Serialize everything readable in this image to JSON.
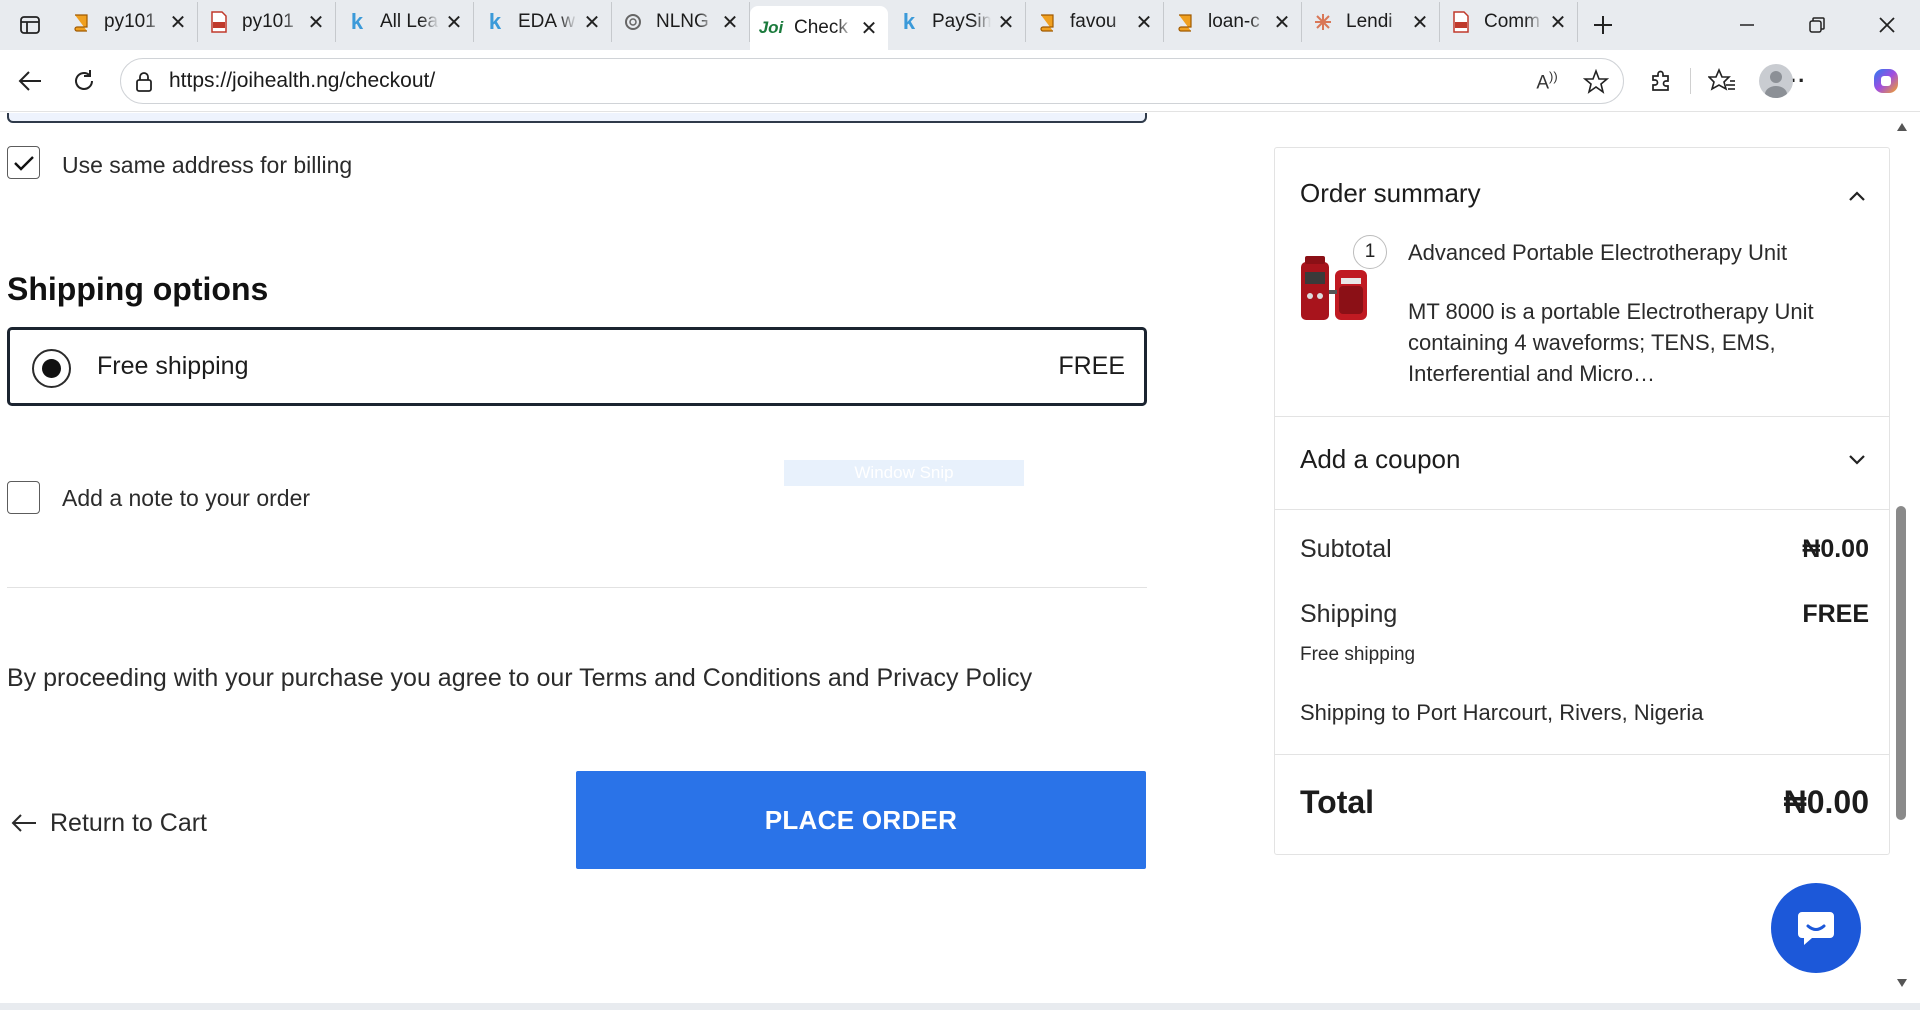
{
  "browser": {
    "tabs": [
      {
        "label": "py101",
        "icon": "book-icon",
        "color": "#f0a020"
      },
      {
        "label": "py101",
        "icon": "pdf-icon",
        "color": "#c0392b"
      },
      {
        "label": "All Lea",
        "icon": "k-icon",
        "color": "#3b9ad9"
      },
      {
        "label": "EDA w",
        "icon": "k-icon",
        "color": "#3b9ad9"
      },
      {
        "label": "NLNG",
        "icon": "openai-icon",
        "color": "#666666"
      },
      {
        "label": "Check",
        "icon": "joi-icon",
        "color": "#1a7a3c",
        "active": true
      },
      {
        "label": "PaySim",
        "icon": "k-icon",
        "color": "#3b9ad9"
      },
      {
        "label": "favou",
        "icon": "book-icon",
        "color": "#f0a020"
      },
      {
        "label": "loan-c",
        "icon": "book-icon",
        "color": "#f0a020"
      },
      {
        "label": "Lendi",
        "icon": "claude-icon",
        "color": "#d97757"
      },
      {
        "label": "Comm",
        "icon": "pdf-icon",
        "color": "#c0392b"
      }
    ],
    "url": "https://joihealth.ng/checkout/"
  },
  "checkout": {
    "billing_same_label": "Use same address for billing",
    "shipping_title": "Shipping options",
    "shipping_option": {
      "name": "Free shipping",
      "price": "FREE"
    },
    "note_label": "Add a note to your order",
    "snip_overlay": "Window Snip",
    "terms_text": "By proceeding with your purchase you agree to our Terms and Conditions and Privacy Policy",
    "return_label": "Return to Cart",
    "place_order_label": "PLACE ORDER"
  },
  "summary": {
    "title": "Order summary",
    "quantity": "1",
    "product_name": "Advanced Portable Electrotherapy Unit",
    "product_desc": "MT 8000 is a portable Electrotherapy Unit containing 4 waveforms; TENS, EMS, Interferential and Micro…",
    "coupon_label": "Add a coupon",
    "subtotal_label": "Subtotal",
    "subtotal_value": "₦0.00",
    "shipping_label": "Shipping",
    "shipping_value": "FREE",
    "shipping_method": "Free shipping",
    "shipping_to": "Shipping to Port Harcourt, Rivers, Nigeria",
    "total_label": "Total",
    "total_value": "₦0.00"
  },
  "colors": {
    "accent": "#2a73e8",
    "chat": "#1c58d9"
  }
}
